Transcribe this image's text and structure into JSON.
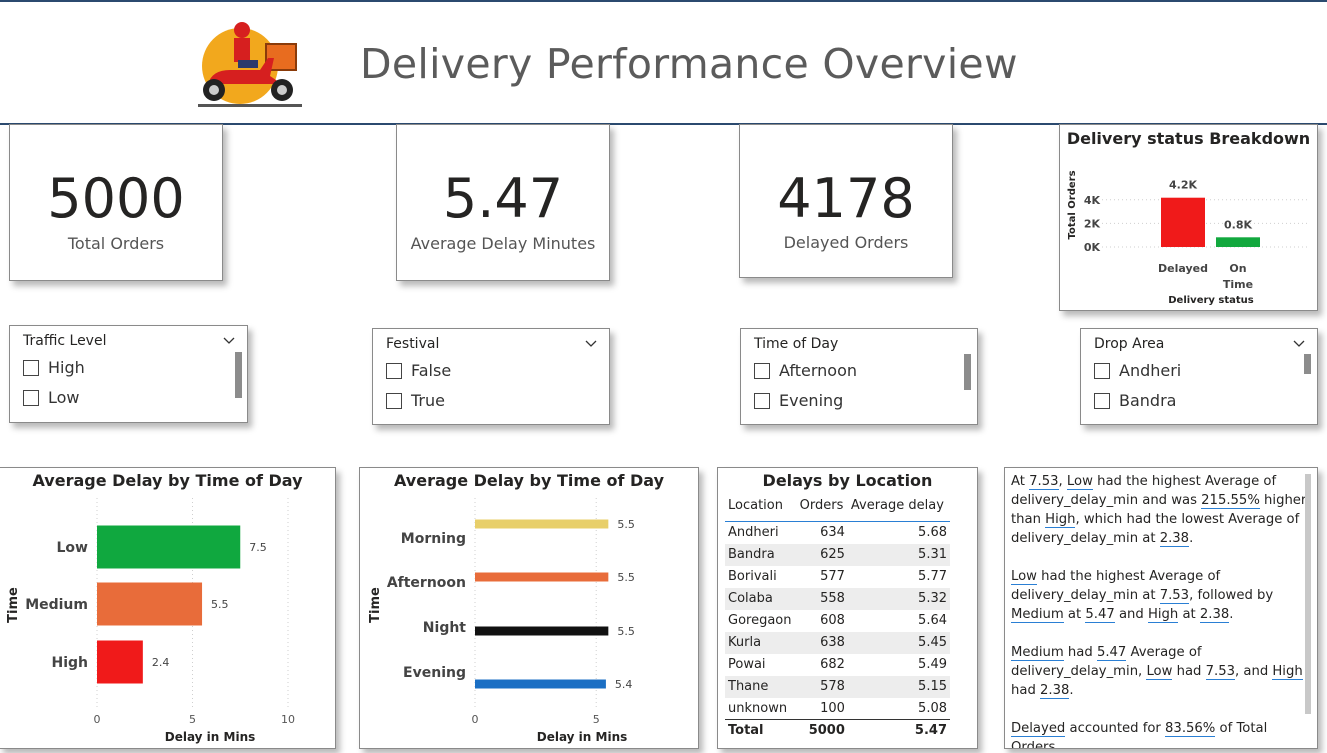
{
  "header": {
    "title": "Delivery Performance Overview",
    "logo_icon": "delivery-scooter-icon"
  },
  "kpis": [
    {
      "value": "5000",
      "label": "Total Orders"
    },
    {
      "value": "5.47",
      "label": "Average Delay Minutes"
    },
    {
      "value": "4178",
      "label": "Delayed Orders"
    }
  ],
  "status_chart": {
    "title": "Delivery status Breakdown",
    "chart_data": {
      "type": "bar",
      "title": "Delivery status Breakdown",
      "categories": [
        "Delayed",
        "On Time"
      ],
      "category_lines": [
        [
          "Delayed"
        ],
        [
          "On",
          "Time"
        ]
      ],
      "values": [
        4178,
        822
      ],
      "data_labels": [
        "4.2K",
        "0.8K"
      ],
      "colors": [
        "#f01a1a",
        "#12a83e"
      ],
      "xlabel": "Delivery status",
      "ylabel": "Total Orders",
      "yticks": [
        "0K",
        "2K",
        "4K"
      ],
      "ylim": [
        0,
        5000
      ],
      "grid": true
    }
  },
  "slicers": [
    {
      "title": "Traffic Level",
      "options": [
        "High",
        "Low"
      ]
    },
    {
      "title": "Festival",
      "options": [
        "False",
        "True"
      ]
    },
    {
      "title": "Time of Day",
      "options": [
        "Afternoon",
        "Evening"
      ]
    },
    {
      "title": "Drop Area",
      "options": [
        "Andheri",
        "Bandra"
      ]
    }
  ],
  "traffic_chart": {
    "title": "Average Delay by Time of Day",
    "chart_data": {
      "type": "bar",
      "orientation": "horizontal",
      "title": "Average Delay by Time of Day",
      "categories": [
        "Low",
        "Medium",
        "High"
      ],
      "values": [
        7.5,
        5.5,
        2.4
      ],
      "data_labels": [
        "7.5",
        "5.5",
        "2.4"
      ],
      "colors": [
        "#10a83f",
        "#e86c3a",
        "#f01a1a"
      ],
      "xlabel": "Delay in Mins",
      "ylabel": "Time",
      "xticks": [
        "0",
        "5",
        "10"
      ],
      "xlim": [
        0,
        10
      ],
      "grid": true
    }
  },
  "time_chart": {
    "title": "Average Delay by Time of Day",
    "chart_data": {
      "type": "bar",
      "orientation": "horizontal",
      "title": "Average Delay by Time of Day",
      "categories": [
        "Morning",
        "Afternoon",
        "Night",
        "Evening"
      ],
      "values": [
        5.5,
        5.5,
        5.5,
        5.4
      ],
      "data_labels": [
        "5.5",
        "5.5",
        "5.5",
        "5.4"
      ],
      "colors": [
        "#e8cf6a",
        "#e86c3a",
        "#111111",
        "#1b6fc4"
      ],
      "xlabel": "Delay in Mins",
      "ylabel": "Time",
      "xticks": [
        "0",
        "5"
      ],
      "xlim": [
        0,
        6.6
      ],
      "grid": true
    }
  },
  "location_table": {
    "title": "Delays by Location",
    "columns": [
      "Location",
      "Orders",
      "Average delay"
    ],
    "rows": [
      [
        "Andheri",
        "634",
        "5.68"
      ],
      [
        "Bandra",
        "625",
        "5.31"
      ],
      [
        "Borivali",
        "577",
        "5.77"
      ],
      [
        "Colaba",
        "558",
        "5.32"
      ],
      [
        "Goregaon",
        "608",
        "5.64"
      ],
      [
        "Kurla",
        "638",
        "5.45"
      ],
      [
        "Powai",
        "682",
        "5.49"
      ],
      [
        "Thane",
        "578",
        "5.15"
      ],
      [
        "unknown",
        "100",
        "5.08"
      ]
    ],
    "total": [
      "Total",
      "5000",
      "5.47"
    ]
  },
  "narrative": {
    "p1": [
      {
        "t": "At ",
        "u": false
      },
      {
        "t": "7.53",
        "u": true
      },
      {
        "t": ", ",
        "u": false
      },
      {
        "t": "Low",
        "u": true
      },
      {
        "t": " had the highest Average of delivery_delay_min and was ",
        "u": false
      },
      {
        "t": "215.55%",
        "u": true
      },
      {
        "t": " higher than ",
        "u": false
      },
      {
        "t": "High",
        "u": true
      },
      {
        "t": ", which had the lowest Average of delivery_delay_min at ",
        "u": false
      },
      {
        "t": "2.38",
        "u": true
      },
      {
        "t": ".",
        "u": false
      }
    ],
    "p2": [
      {
        "t": "Low",
        "u": true
      },
      {
        "t": " had the highest Average of delivery_delay_min at ",
        "u": false
      },
      {
        "t": "7.53",
        "u": true
      },
      {
        "t": ", followed by ",
        "u": false
      },
      {
        "t": "Medium",
        "u": true
      },
      {
        "t": " at ",
        "u": false
      },
      {
        "t": "5.47",
        "u": true
      },
      {
        "t": " and ",
        "u": false
      },
      {
        "t": "High",
        "u": true
      },
      {
        "t": " at ",
        "u": false
      },
      {
        "t": "2.38",
        "u": true
      },
      {
        "t": ".",
        "u": false
      }
    ],
    "p3": [
      {
        "t": "Medium",
        "u": true
      },
      {
        "t": " had ",
        "u": false
      },
      {
        "t": "5.47",
        "u": true
      },
      {
        "t": " Average of delivery_delay_min, ",
        "u": false
      },
      {
        "t": "Low",
        "u": true
      },
      {
        "t": " had ",
        "u": false
      },
      {
        "t": "7.53",
        "u": true
      },
      {
        "t": ", and ",
        "u": false
      },
      {
        "t": "High",
        "u": true
      },
      {
        "t": " had ",
        "u": false
      },
      {
        "t": "2.38",
        "u": true
      },
      {
        "t": ".",
        "u": false
      }
    ],
    "p4": [
      {
        "t": "Delayed",
        "u": true
      },
      {
        "t": " accounted for ",
        "u": false
      },
      {
        "t": "83.56%",
        "u": true
      },
      {
        "t": " of Total Orders.",
        "u": false
      }
    ]
  }
}
